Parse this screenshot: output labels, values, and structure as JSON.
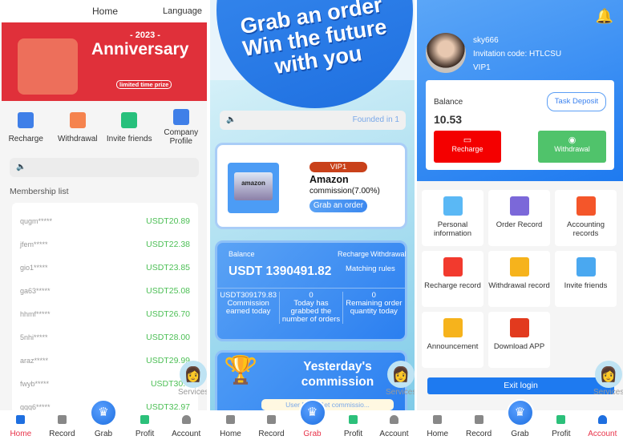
{
  "nav": {
    "items": [
      "Home",
      "Record",
      "Grab",
      "Profit",
      "Account"
    ]
  },
  "services_label": "Services",
  "home": {
    "title": "Home",
    "language": "Language",
    "banner": {
      "year": "- 2023 -",
      "title": "Anniversary",
      "tag": "limited time prize"
    },
    "quick_actions": [
      "Recharge",
      "Withdrawal",
      "Invite friends",
      "Company Profile"
    ],
    "membership_title": "Membership list",
    "members": [
      {
        "user": "qugm*****",
        "amount": "USDT20.89"
      },
      {
        "user": "jfem*****",
        "amount": "USDT22.38"
      },
      {
        "user": "gio1*****",
        "amount": "USDT23.85"
      },
      {
        "user": "ga63*****",
        "amount": "USDT25.08"
      },
      {
        "user": "hhmf*****",
        "amount": "USDT26.70"
      },
      {
        "user": "5nhi*****",
        "amount": "USDT28.00"
      },
      {
        "user": "araz*****",
        "amount": "USDT29.99"
      },
      {
        "user": "fwyb*****",
        "amount": "USDT30.0"
      },
      {
        "user": "qqq6*****",
        "amount": "USDT32.97"
      }
    ]
  },
  "grab": {
    "hero_lines": [
      "Grab an order",
      "Win the future",
      "with you"
    ],
    "notice": "Founded in 1",
    "vip": "VIP1",
    "brand": "Amazon",
    "logo_text": "amazon",
    "commission": "commission(7.00%)",
    "grab_button": "Grab an order",
    "balance_label": "Balance",
    "recharge": "Recharge",
    "withdrawal": "Withdrawal",
    "balance": "USDT 1390491.82",
    "matching_rules": "Matching rules",
    "stats": [
      {
        "value": "USDT309179.83",
        "label": "Commission earned today"
      },
      {
        "value": "0",
        "label": "Today has grabbed the number of orders"
      },
      {
        "value": "0",
        "label": "Remaining order quantity today"
      }
    ],
    "yesterday": "Yesterday's commission",
    "ticker": "User [96... Get commissio..."
  },
  "account": {
    "username": "sky666",
    "invitation": "Invitation code:  HTLCSU",
    "vip": "VIP1",
    "balance_label": "Balance",
    "balance": "10.53",
    "task_deposit": "Task Deposit",
    "recharge": "Recharge",
    "withdrawal": "Withdrawal",
    "menu": [
      {
        "label": "Personal information",
        "color": "#5ab8f5"
      },
      {
        "label": "Order Record",
        "color": "#7b68d9"
      },
      {
        "label": "Accounting records",
        "color": "#f4562a"
      },
      {
        "label": "Recharge record",
        "color": "#f23a2e"
      },
      {
        "label": "Withdrawal record",
        "color": "#f6b31c"
      },
      {
        "label": "Invite friends",
        "color": "#4aa8f0"
      },
      {
        "label": "Announcement",
        "color": "#f6b31c"
      },
      {
        "label": "Download APP",
        "color": "#e23a1e"
      }
    ],
    "exit": "Exit login"
  },
  "colors": {
    "primary": "#1e6fe0",
    "green": "#4cbf55",
    "red": "#f40000",
    "active_nav": "#e8334a"
  }
}
